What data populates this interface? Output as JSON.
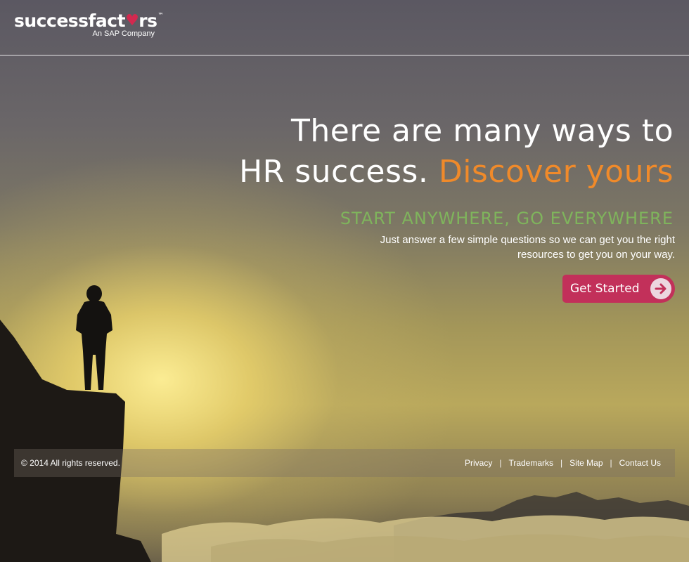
{
  "brand": {
    "logo_prefix": "successfact",
    "logo_heart": "♥",
    "logo_suffix": "rs",
    "logo_tm": "™",
    "subtitle": "An SAP Company"
  },
  "hero": {
    "headline_line1": "There are many ways to",
    "headline_line2_start": "HR success.",
    "headline_line2_accent": "Discover yours",
    "tagline": "START ANYWHERE, GO EVERYWHERE",
    "subtext_line1": "Just answer a few simple questions so we can get you the right",
    "subtext_line2": "resources to get you on your way.",
    "cta_label": "Get Started"
  },
  "footer": {
    "copyright": "© 2014 All rights reserved.",
    "links": [
      "Privacy",
      "Trademarks",
      "Site Map",
      "Contact Us"
    ],
    "separator": "|"
  },
  "colors": {
    "accent_orange": "#f08a2a",
    "tagline_green": "#7fb45c",
    "cta_magenta": "#c2305a",
    "heart_red": "#d2294f"
  },
  "icons": {
    "cta": "arrow-right-circle-icon",
    "logo": "heart-icon"
  }
}
